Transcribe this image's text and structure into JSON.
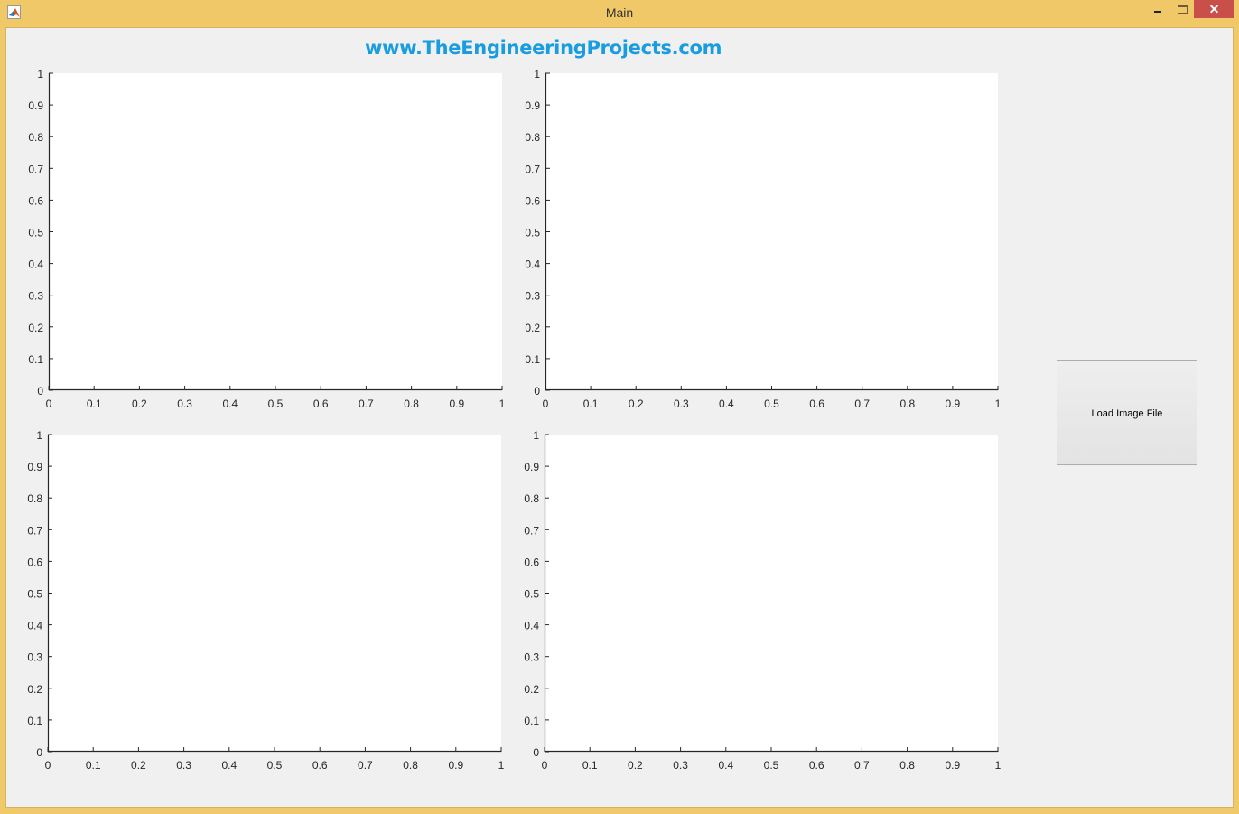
{
  "window": {
    "title": "Main",
    "icon": "matlab-icon",
    "controls": {
      "minimize": "minimize-icon",
      "maximize": "maximize-icon",
      "close": "✕"
    }
  },
  "header": {
    "site_title": "www.TheEngineeringProjects.com"
  },
  "buttons": {
    "load_image": "Load Image File"
  },
  "colors": {
    "title_bar": "#f0c868",
    "site_title": "#1a9de0",
    "close_button": "#c9504a"
  },
  "chart_data": [
    {
      "id": "axes1",
      "type": "line",
      "title": "",
      "xlabel": "",
      "ylabel": "",
      "series": [],
      "xlim": [
        0,
        1
      ],
      "ylim": [
        0,
        1
      ],
      "grid": false,
      "xticks": [
        "0",
        "0.1",
        "0.2",
        "0.3",
        "0.4",
        "0.5",
        "0.6",
        "0.7",
        "0.8",
        "0.9",
        "1"
      ],
      "yticks": [
        "0",
        "0.1",
        "0.2",
        "0.3",
        "0.4",
        "0.5",
        "0.6",
        "0.7",
        "0.8",
        "0.9",
        "1"
      ]
    },
    {
      "id": "axes2",
      "type": "line",
      "title": "",
      "xlabel": "",
      "ylabel": "",
      "series": [],
      "xlim": [
        0,
        1
      ],
      "ylim": [
        0,
        1
      ],
      "grid": false,
      "xticks": [
        "0",
        "0.1",
        "0.2",
        "0.3",
        "0.4",
        "0.5",
        "0.6",
        "0.7",
        "0.8",
        "0.9",
        "1"
      ],
      "yticks": [
        "0",
        "0.1",
        "0.2",
        "0.3",
        "0.4",
        "0.5",
        "0.6",
        "0.7",
        "0.8",
        "0.9",
        "1"
      ]
    },
    {
      "id": "axes3",
      "type": "line",
      "title": "",
      "xlabel": "",
      "ylabel": "",
      "series": [],
      "xlim": [
        0,
        1
      ],
      "ylim": [
        0,
        1
      ],
      "grid": false,
      "xticks": [
        "0",
        "0.1",
        "0.2",
        "0.3",
        "0.4",
        "0.5",
        "0.6",
        "0.7",
        "0.8",
        "0.9",
        "1"
      ],
      "yticks": [
        "0",
        "0.1",
        "0.2",
        "0.3",
        "0.4",
        "0.5",
        "0.6",
        "0.7",
        "0.8",
        "0.9",
        "1"
      ]
    },
    {
      "id": "axes4",
      "type": "line",
      "title": "",
      "xlabel": "",
      "ylabel": "",
      "series": [],
      "xlim": [
        0,
        1
      ],
      "ylim": [
        0,
        1
      ],
      "grid": false,
      "xticks": [
        "0",
        "0.1",
        "0.2",
        "0.3",
        "0.4",
        "0.5",
        "0.6",
        "0.7",
        "0.8",
        "0.9",
        "1"
      ],
      "yticks": [
        "0",
        "0.1",
        "0.2",
        "0.3",
        "0.4",
        "0.5",
        "0.6",
        "0.7",
        "0.8",
        "0.9",
        "1"
      ]
    }
  ]
}
